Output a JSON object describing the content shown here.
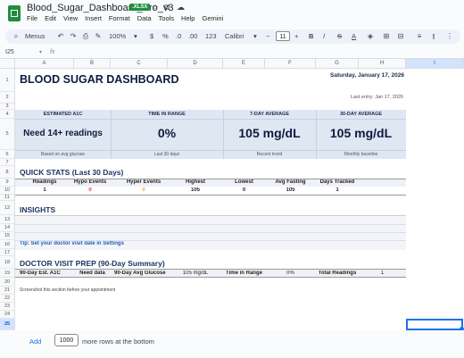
{
  "title_bar": {
    "doc_title": "Blood_Sugar_Dashboard_Pro_v3",
    "badge": ".XLSX",
    "menu": [
      "File",
      "Edit",
      "View",
      "Insert",
      "Format",
      "Data",
      "Tools",
      "Help",
      "Gemini"
    ]
  },
  "toolbar": {
    "menus_label": "Menus",
    "zoom": "100%",
    "currency": "$",
    "percent": "%",
    "dec_dec": ".0",
    "dec_inc": ".00",
    "number_format": "123",
    "font": "Calibri",
    "font_size": "11",
    "bold": "B",
    "italic": "I",
    "strike": "S",
    "text_color": "A"
  },
  "formula_bar": {
    "cell_ref": "I25",
    "fx": "fx"
  },
  "columns": [
    "A",
    "B",
    "C",
    "D",
    "E",
    "F",
    "G",
    "H",
    "I"
  ],
  "rows": [
    "1",
    "2",
    "3",
    "4",
    "5",
    "6",
    "7",
    "8",
    "9",
    "10",
    "11",
    "12",
    "13",
    "14",
    "15",
    "16",
    "17",
    "18",
    "19",
    "20",
    "21",
    "22",
    "23",
    "24",
    "25",
    "26"
  ],
  "dashboard": {
    "title": "BLOOD SUGAR DASHBOARD",
    "date": "Saturday, January 17, 2026",
    "last_entry": "Last entry: Jan 17, 2026",
    "cards": [
      {
        "header": "ESTIMATED A1C",
        "value": "Need 14+ readings",
        "sub": "Based on avg glucose"
      },
      {
        "header": "TIME IN RANGE",
        "value": "0%",
        "sub": "Last 30 days"
      },
      {
        "header": "7-DAY AVERAGE",
        "value": "105 mg/dL",
        "sub": "Recent trend"
      },
      {
        "header": "30-DAY AVERAGE",
        "value": "105 mg/dL",
        "sub": "Monthly baseline"
      }
    ],
    "quick_stats_title": "QUICK STATS (Last 30 Days)",
    "quick_stats_headers": [
      "Readings",
      "Hypo Events",
      "Hyper Events",
      "Highest",
      "Lowest",
      "Avg Fasting",
      "Days Tracked"
    ],
    "quick_stats_values": [
      "1",
      "0",
      "0",
      "105",
      "0",
      "105",
      "1"
    ],
    "insights_title": "INSIGHTS",
    "tip": "Tip: Set your doctor visit date in Settings",
    "doctor_title": "DOCTOR VISIT PREP (90-Day Summary)",
    "doctor_row": [
      "90-Day Est. A1C",
      "Need data",
      "90-Day Avg Glucose",
      "105 mg/dL",
      "Time in Range",
      "0%",
      "Total Readings",
      "1"
    ],
    "screenshot_note": "Screenshot this section before your appointment"
  },
  "colors": {
    "accent_red": "#e53935",
    "accent_orange": "#f4a442",
    "heading": "#1a3563",
    "band": "#dfe7f3"
  },
  "footer": {
    "add_label": "Add",
    "rows_value": "1000",
    "more_text": "more rows at the bottom"
  }
}
